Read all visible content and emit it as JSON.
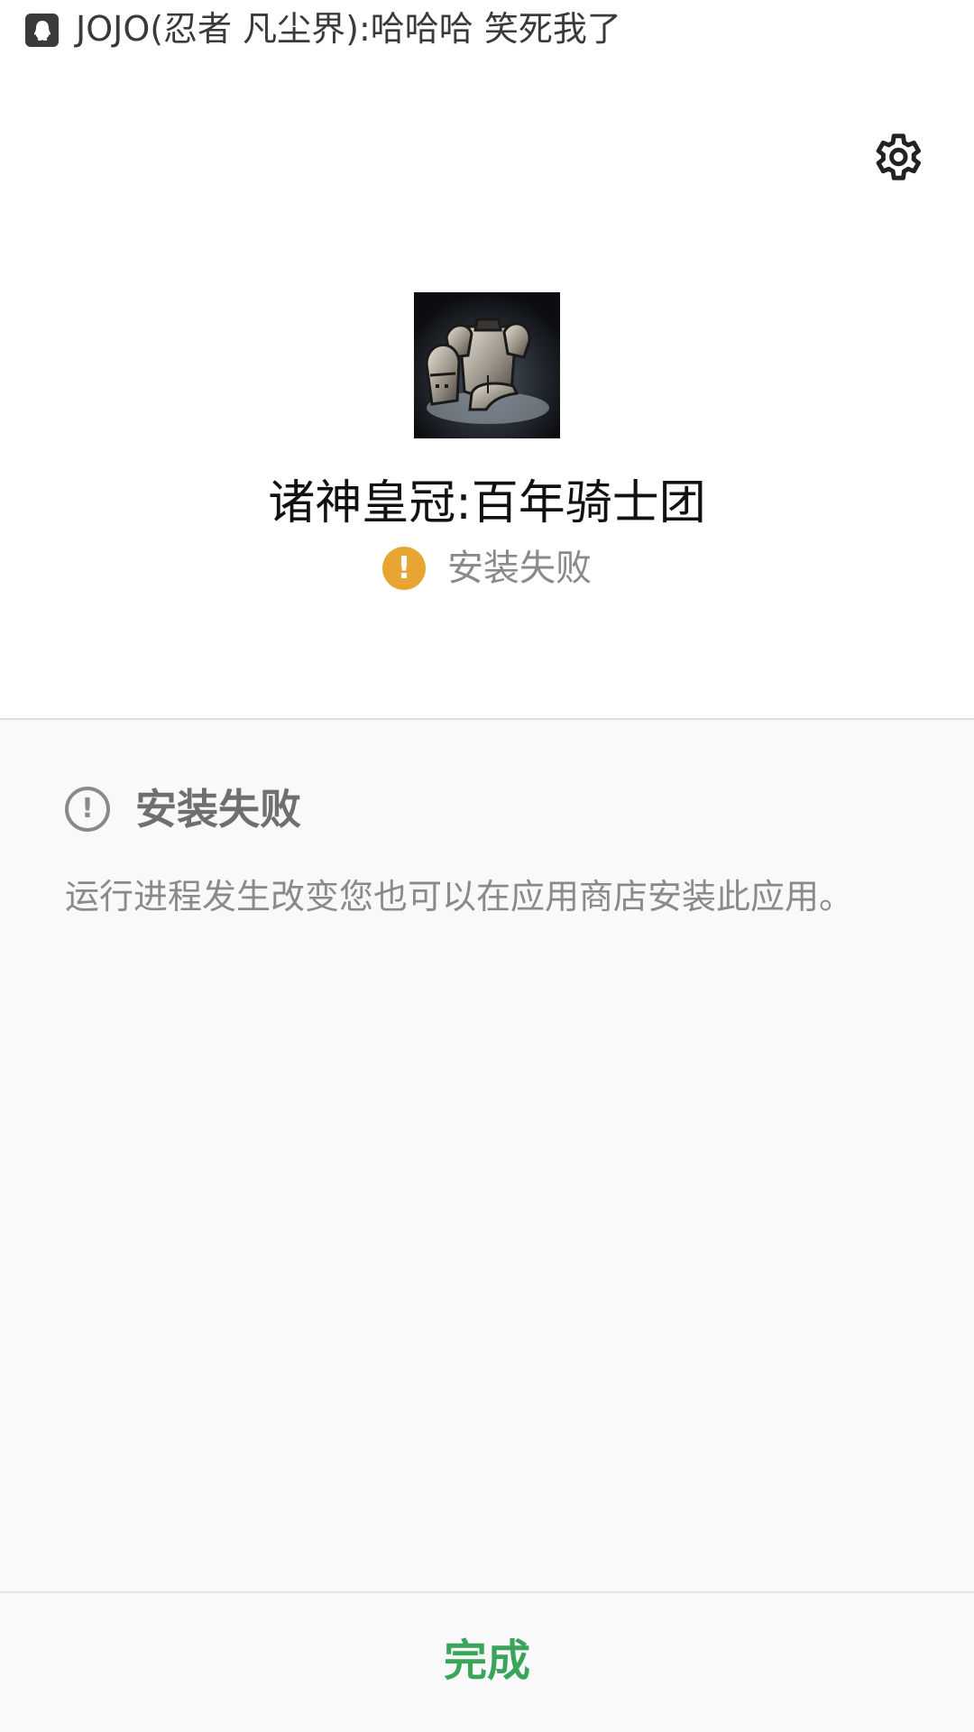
{
  "notification": {
    "icon": "qq-icon",
    "text": "JOJO(忍者 凡尘界):哈哈哈 笑死我了"
  },
  "header": {
    "settings_icon": "gear-icon"
  },
  "app": {
    "icon": "armor-game-icon",
    "name": "诸神皇冠:百年骑士团",
    "status_icon": "warning-icon",
    "status": "安装失败"
  },
  "detail": {
    "icon": "info-icon",
    "title": "安装失败",
    "message": "运行进程发生改变您也可以在应用商店安装此应用。"
  },
  "footer": {
    "done_label": "完成"
  },
  "colors": {
    "warning": "#e8a534",
    "accent_green": "#3aa55a",
    "panel_bg": "#f9f9f9"
  }
}
